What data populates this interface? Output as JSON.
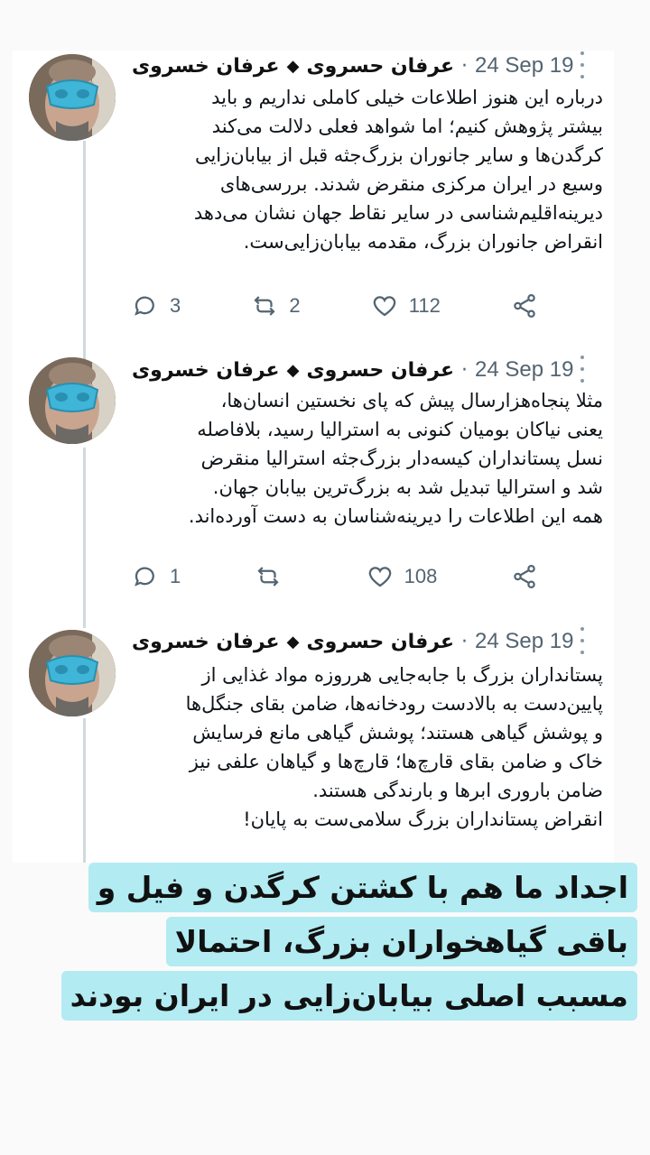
{
  "accent_color": "#b2ebf2",
  "tweets": [
    {
      "handle": "عرفان خسروی",
      "name": "عرفان حسروی",
      "date": "24 Sep 19",
      "body": "درباره این هنوز اطلاعات خیلی کاملی نداریم و باید\nبیشتر پژوهش کنیم؛ اما شواهد فعلی دلالت می‌کند\nکرگدن‌ها و سایر جانوران بزرگ‌جثه قبل از بیابان‌زایی\nوسیع در ایران مرکزی منقرض شدند. بررسی‌های\nدیرینه‌اقلیم‌شناسی در سایر نقاط جهان نشان می‌دهد\nانقراض جانوران بزرگ، مقدمه بیابان‌زایی‌ست.",
      "replies": "3",
      "retweets": "2",
      "likes": "112",
      "icons": [
        "reply-icon",
        "retweet-icon",
        "like-icon",
        "share-icon",
        "more-icon"
      ]
    },
    {
      "handle": "عرفان خسروی",
      "name": "عرفان حسروی",
      "date": "24 Sep 19",
      "body": "مثلا پنجاه‌هزارسال پیش که پای نخستین انسان‌ها،\nیعنی نیاکان بومیان کنونی به استرالیا رسید، بلافاصله\nنسل پستانداران کیسه‌دار بزرگ‌جثه استرالیا منقرض\nشد و استرالیا تبدیل شد به بزرگ‌ترین بیابان جهان.\nهمه این اطلاعات را دیرینه‌شناسان به دست آورده‌اند.",
      "replies": "1",
      "retweets": "",
      "likes": "108",
      "icons": [
        "reply-icon",
        "retweet-icon",
        "like-icon",
        "share-icon",
        "more-icon"
      ]
    },
    {
      "handle": "عرفان خسروی",
      "name": "عرفان حسروی",
      "date": "24 Sep 19",
      "body": "پستانداران بزرگ با جابه‌جایی هرروزه مواد غذایی از\nپایین‌دست به بالادست رودخانه‌ها، ضامن بقای جنگل‌ها\nو پوشش گیاهی هستند؛ پوشش گیاهی مانع فرسایش\nخاک و ضامن بقای قارچ‌ها؛ قارچ‌ها و گیاهان علفی نیز\nضامن باروری ابرها و بارندگی هستند.\nانقراض پستانداران بزرگ سلامی‌ست به پایان!",
      "icons": [
        "more-icon"
      ]
    }
  ],
  "overlay": {
    "line1": "اجداد ما هم با کشتن کرگدن و فیل و",
    "line2": "باقی گیاهخواران بزرگ، احتمالا",
    "line3": "مسبب اصلی بیابان‌زایی در ایران بودند"
  }
}
